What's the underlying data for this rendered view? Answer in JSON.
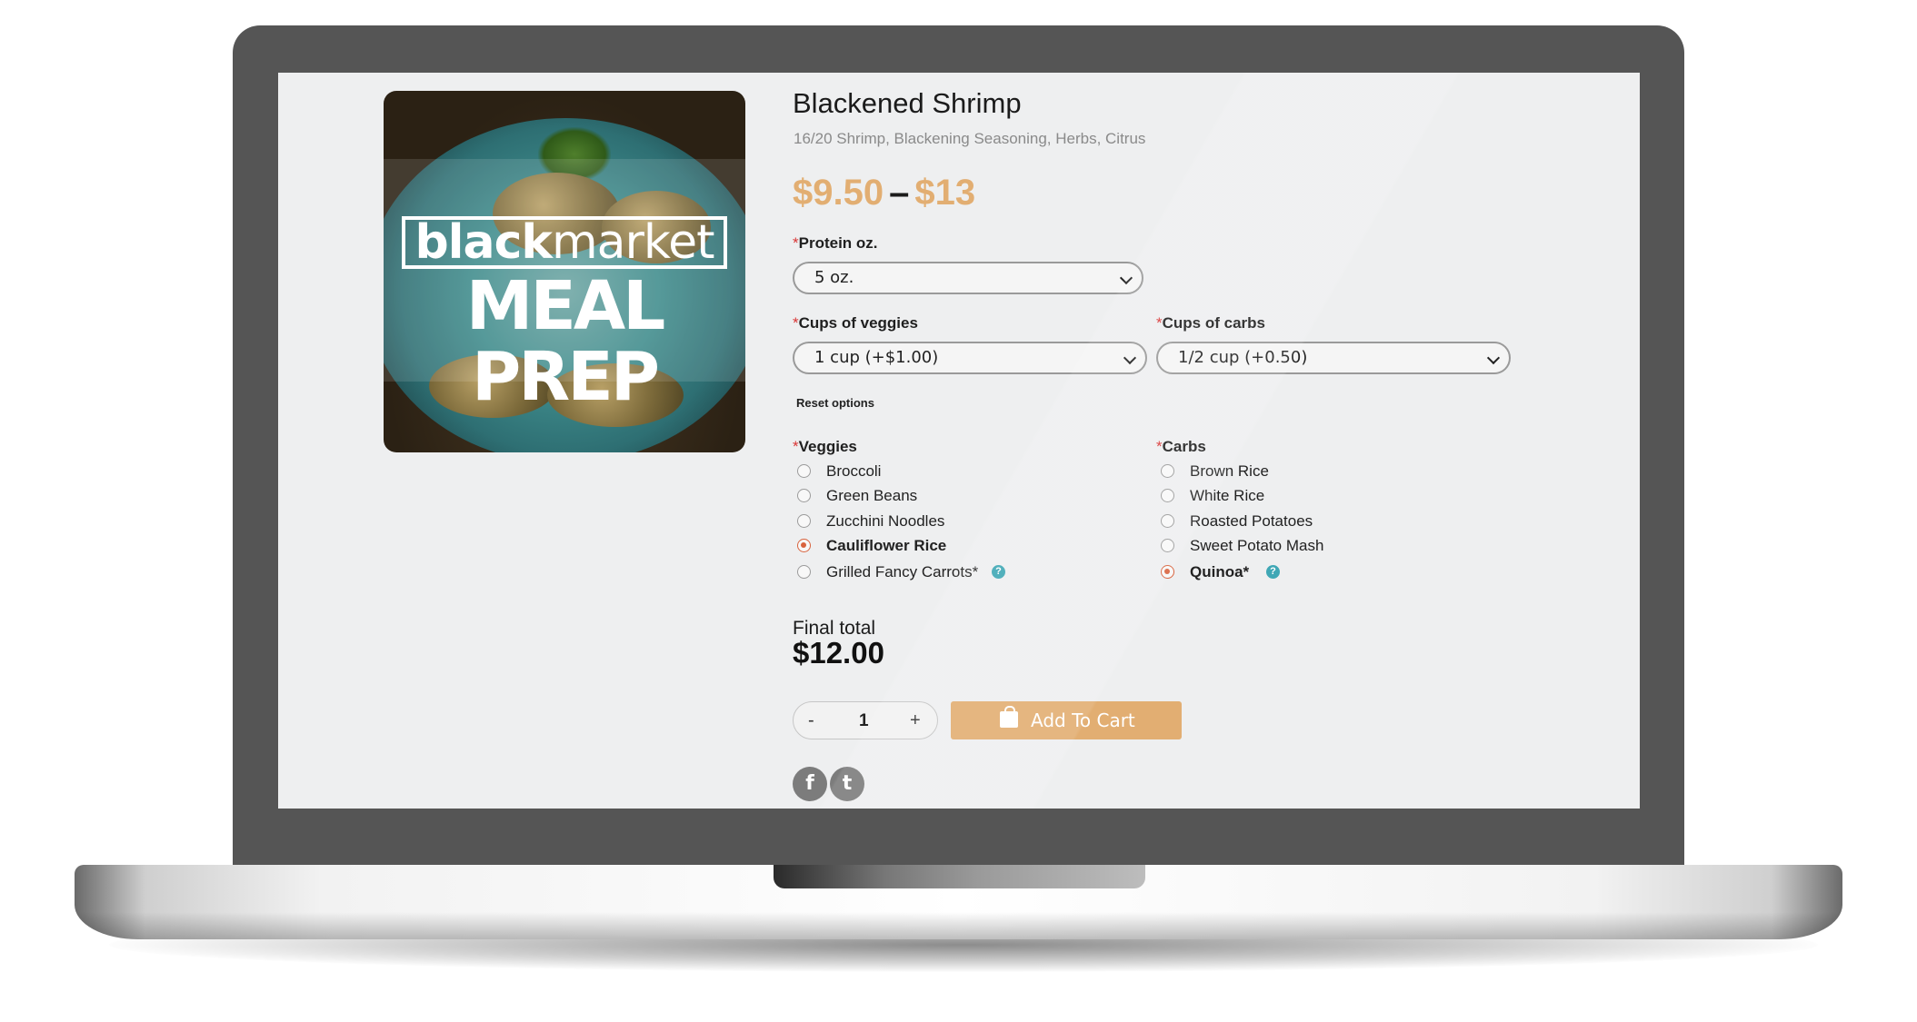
{
  "product": {
    "image_logo_line1_bold": "black",
    "image_logo_line1_rest": "market",
    "image_logo_line2": "MEAL PREP",
    "title": "Blackened Shrimp",
    "subtitle": "16/20 Shrimp, Blackening Seasoning, Herbs, Citrus",
    "price_min": "$9.50",
    "price_sep": "–",
    "price_max": "$13"
  },
  "options": {
    "required_mark": "*",
    "protein": {
      "label": "Protein oz.",
      "value": "5 oz."
    },
    "veggie_cups": {
      "label": "Cups of veggies",
      "value": "1 cup (+$1.00)"
    },
    "carb_cups": {
      "label": "Cups of carbs",
      "value": "1/2 cup (+0.50)"
    },
    "reset_label": "Reset options"
  },
  "veggies": {
    "label": "Veggies",
    "items": [
      {
        "label": "Broccoli",
        "checked": false
      },
      {
        "label": "Green Beans",
        "checked": false
      },
      {
        "label": "Zucchini Noodles",
        "checked": false
      },
      {
        "label": "Cauliflower Rice",
        "checked": true
      },
      {
        "label": "Grilled Fancy Carrots*",
        "checked": false,
        "help": true
      }
    ]
  },
  "carbs": {
    "label": "Carbs",
    "items": [
      {
        "label": "Brown Rice",
        "checked": false
      },
      {
        "label": "White Rice",
        "checked": false
      },
      {
        "label": "Roasted Potatoes",
        "checked": false
      },
      {
        "label": "Sweet Potato Mash",
        "checked": false
      },
      {
        "label": "Quinoa*",
        "checked": true,
        "help": true
      }
    ]
  },
  "help_glyph": "?",
  "total": {
    "label": "Final total",
    "value": "$12.00"
  },
  "quantity": {
    "minus": "-",
    "value": "1",
    "plus": "+"
  },
  "cart_button": {
    "label": "Add To Cart",
    "icon": "shopping-bag-icon"
  },
  "social": {
    "facebook_glyph": "f",
    "twitter_glyph": "t"
  },
  "colors": {
    "accent": "#e2ae72",
    "radio_checked": "#d8633e",
    "help": "#3fa7b5",
    "required": "#d93636"
  }
}
